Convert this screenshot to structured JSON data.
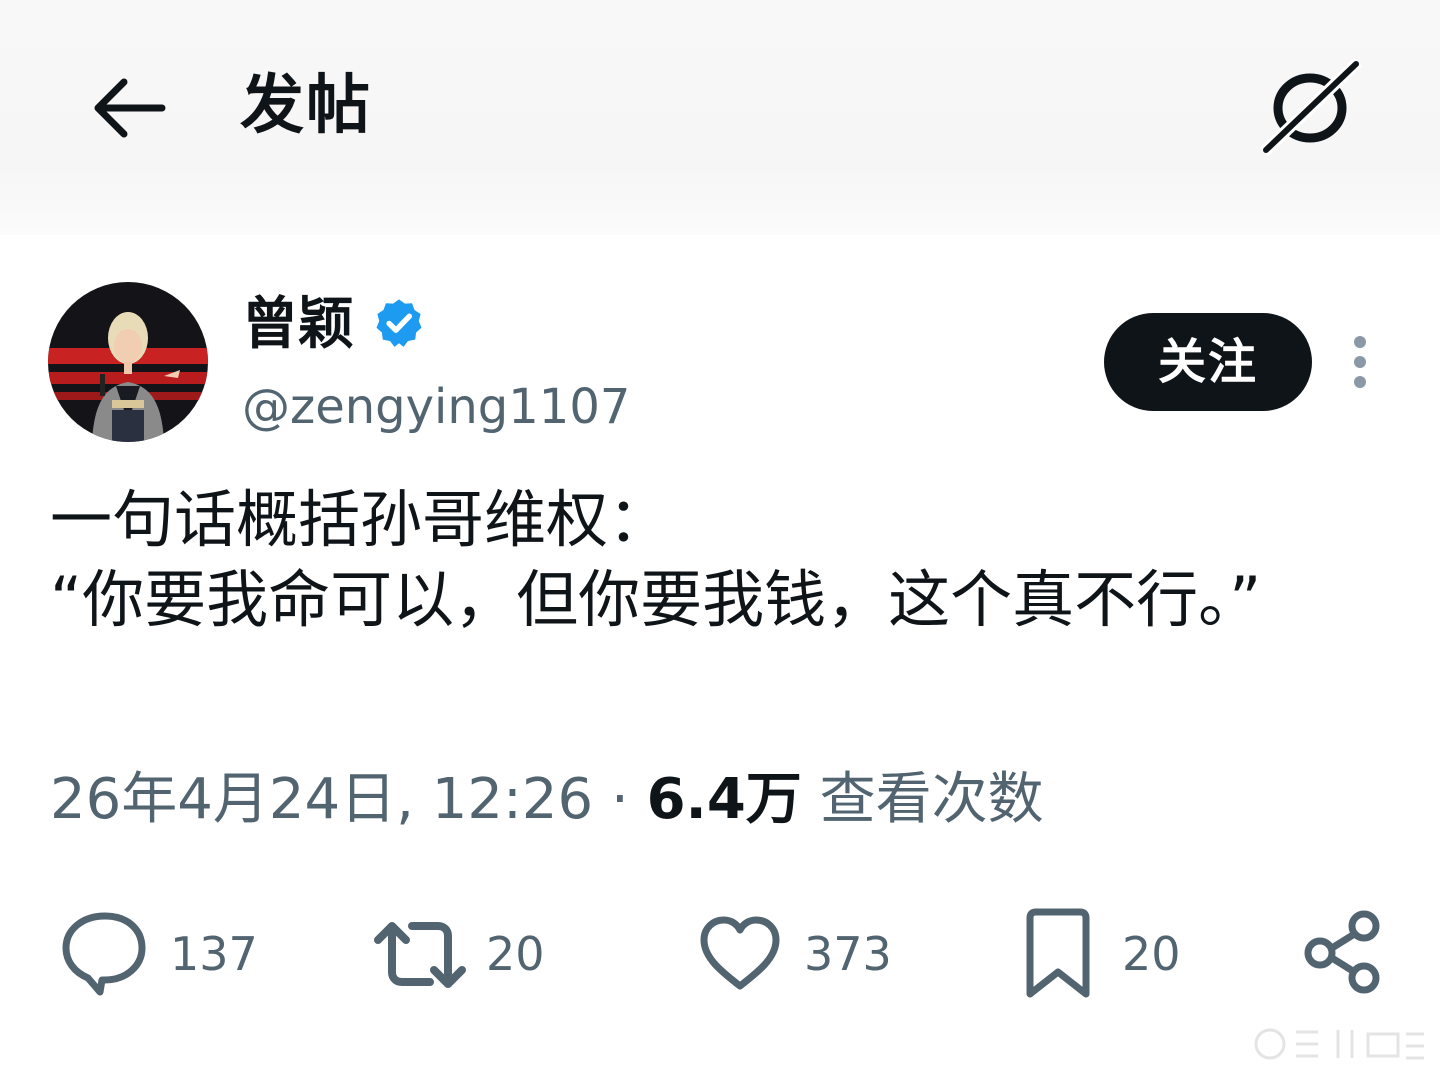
{
  "header": {
    "title": "发帖"
  },
  "author": {
    "name": "曾颖",
    "handle": "@zengying1107",
    "follow_label": "关注"
  },
  "post": {
    "text": "一句话概括孙哥维权：\n“你要我命可以，但你要我钱，这个真不行。”"
  },
  "meta": {
    "timestamp": "26年4月24日, 12:26",
    "separator": "·",
    "views_count": "6.4万",
    "views_label": "查看次数"
  },
  "actions": {
    "replies": "137",
    "reposts": "20",
    "likes": "373",
    "bookmarks": "20"
  },
  "colors": {
    "text": "#0f1419",
    "secondary": "#536471",
    "verified": "#1d9bf0",
    "button_bg": "#0f1419"
  },
  "icons": [
    "back-arrow-icon",
    "grok-icon",
    "verified-badge-icon",
    "more-icon",
    "reply-icon",
    "repost-icon",
    "like-icon",
    "bookmark-icon",
    "share-icon"
  ]
}
